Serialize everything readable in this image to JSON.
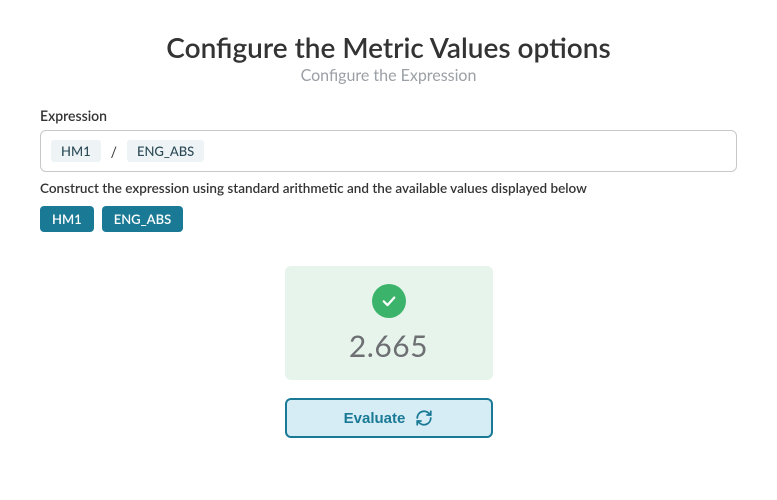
{
  "header": {
    "title": "Configure the Metric Values options",
    "subtitle": "Configure the Expression"
  },
  "expression": {
    "label": "Expression",
    "tokens": [
      "HM1",
      "/",
      "ENG_ABS"
    ],
    "hint": "Construct the expression using standard arithmetic and the available values displayed below"
  },
  "available_values": [
    "HM1",
    "ENG_ABS"
  ],
  "result": {
    "status": "success",
    "value": "2.665"
  },
  "actions": {
    "evaluate_label": "Evaluate"
  },
  "colors": {
    "accent": "#1a7a96",
    "success": "#3cb36a",
    "result_bg": "#e7f4ec"
  }
}
